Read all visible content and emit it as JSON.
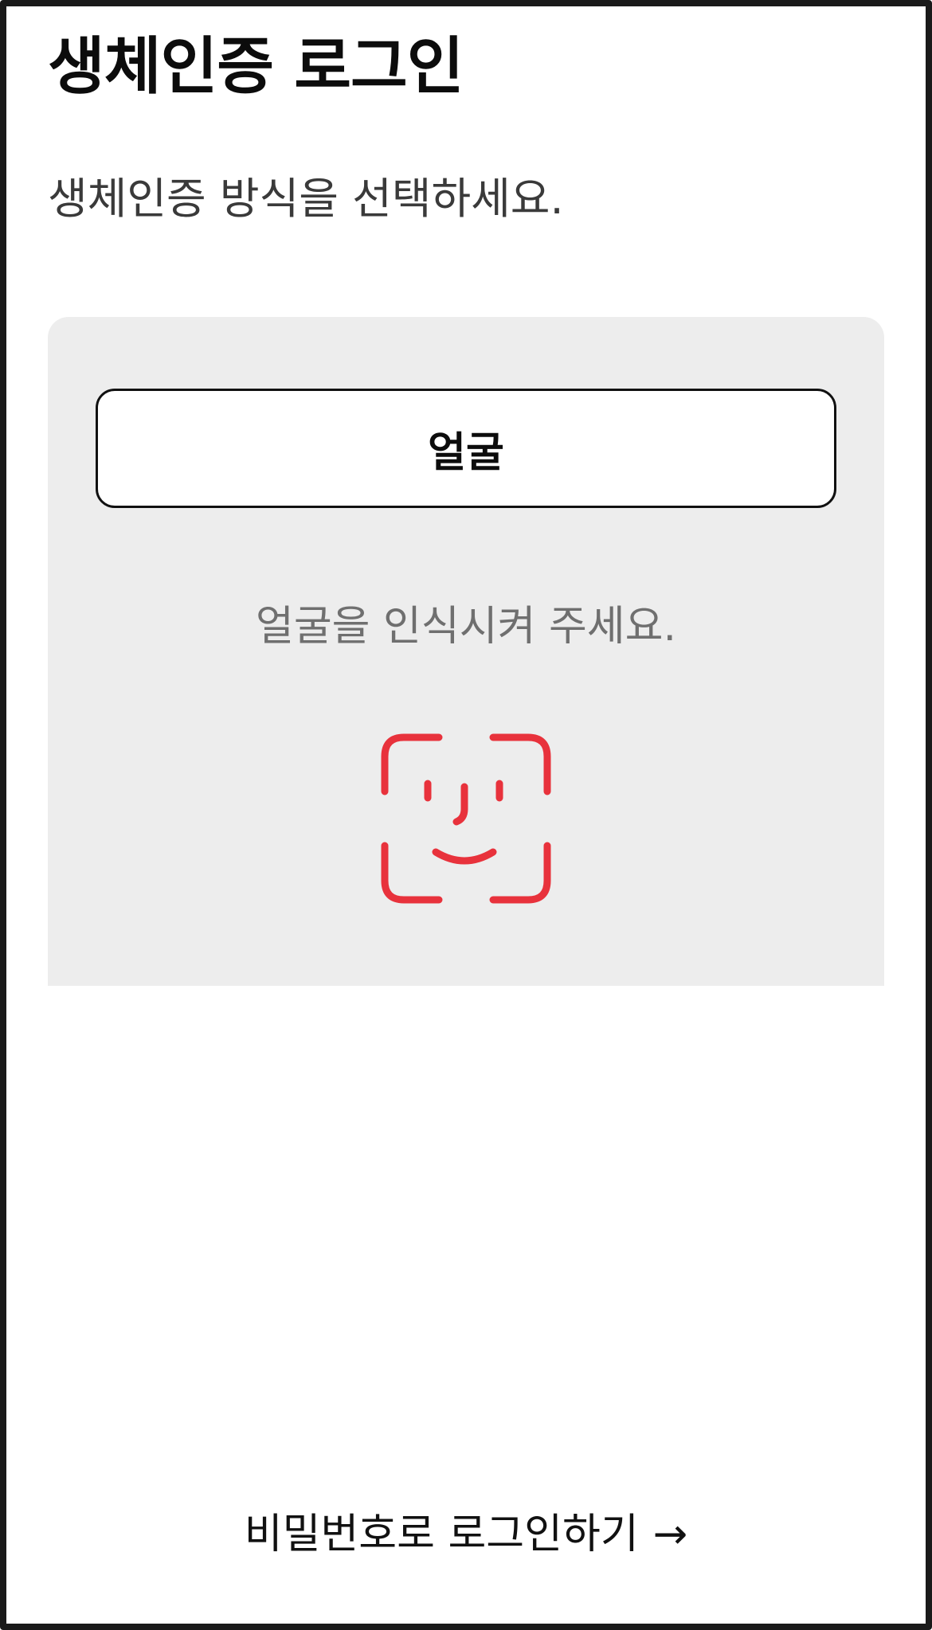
{
  "header": {
    "title": "생체인증 로그인",
    "subtitle": "생체인증 방식을 선택하세요."
  },
  "biometric_panel": {
    "method_label": "얼굴",
    "instruction": "얼굴을 인식시켜 주세요.",
    "icon": "face-id-icon",
    "icon_color": "#e8323c",
    "background_color": "#ededed"
  },
  "footer": {
    "password_login_label": "비밀번호로 로그인하기",
    "arrow_icon": "arrow-right-icon"
  }
}
